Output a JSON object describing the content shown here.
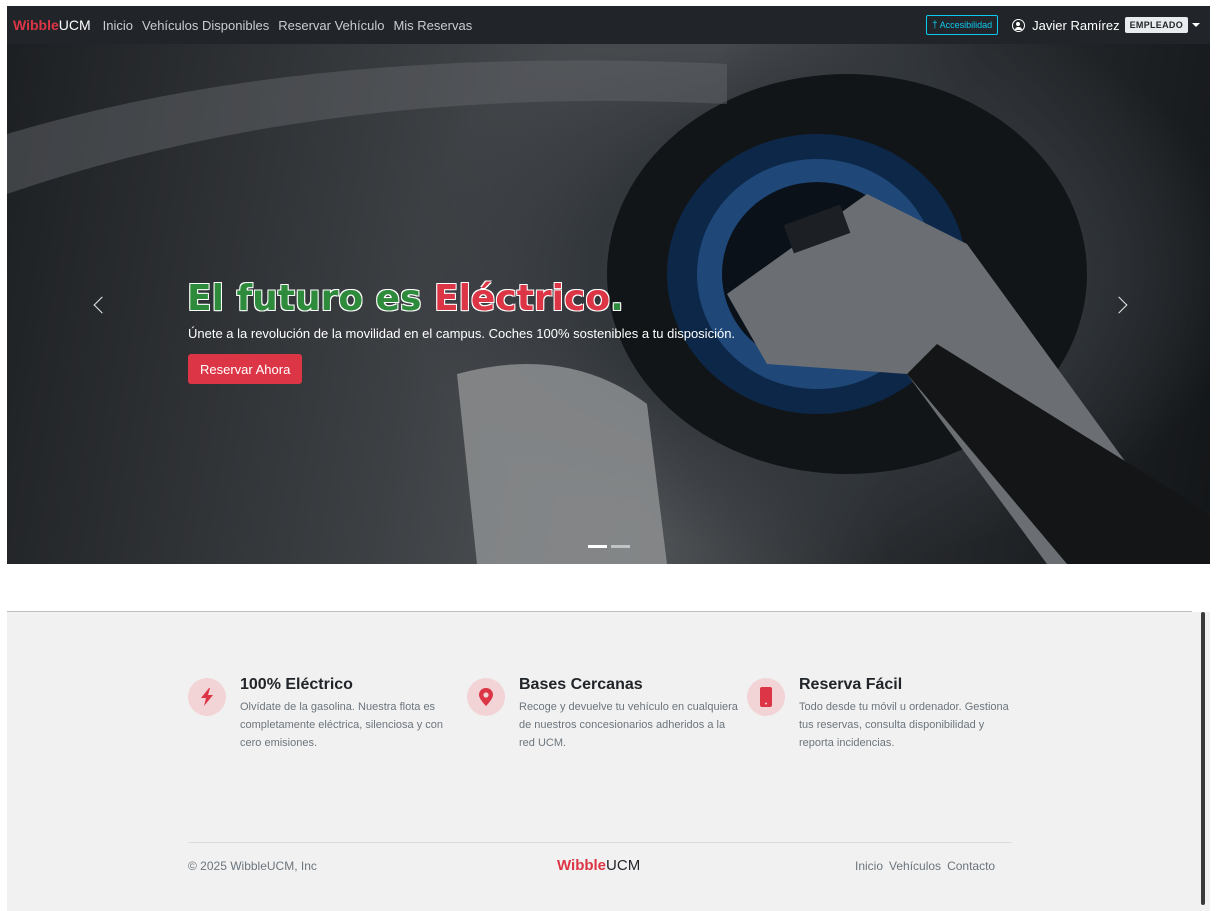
{
  "colors": {
    "accent": "#dc3545",
    "accent_green": "#2e8b3c",
    "navbar_bg": "#212529",
    "info": "#0dcaf0"
  },
  "navbar": {
    "brand_red": "Wibble",
    "brand_rest": "UCM",
    "links": [
      "Inicio",
      "Vehículos Disponibles",
      "Reservar Vehículo",
      "Mis Reservas"
    ],
    "accessibility_label": "Accesibilidad",
    "accessibility_icon": "accessibility-icon",
    "user_icon": "user-circle-icon",
    "user_name": "Javier Ramírez",
    "role_badge": "EMPLEADO"
  },
  "hero": {
    "title_part1": "El futuro es ",
    "title_part2": "Eléctrico",
    "title_part3": ".",
    "subtitle": "Únete a la revolución de la movilidad en el campus. Coches 100% sostenibles a tu disposición.",
    "button_label": "Reservar Ahora",
    "active_slide": 1,
    "slide_count": 2
  },
  "features": [
    {
      "icon": "lightning-icon",
      "title": "100% Eléctrico",
      "text": "Olvídate de la gasolina. Nuestra flota es completamente eléctrica, silenciosa y con cero emisiones."
    },
    {
      "icon": "map-pin-icon",
      "title": "Bases Cercanas",
      "text": "Recoge y devuelve tu vehículo en cualquiera de nuestros concesionarios adheridos a la red UCM."
    },
    {
      "icon": "phone-icon",
      "title": "Reserva Fácil",
      "text": "Todo desde tu móvil u ordenador. Gestiona tus reservas, consulta disponibilidad y reporta incidencias."
    }
  ],
  "footer": {
    "copyright": "© 2025 WibbleUCM, Inc",
    "brand_red": "Wibble",
    "brand_rest": "UCM",
    "links": [
      "Inicio",
      "Vehículos",
      "Contacto"
    ]
  }
}
